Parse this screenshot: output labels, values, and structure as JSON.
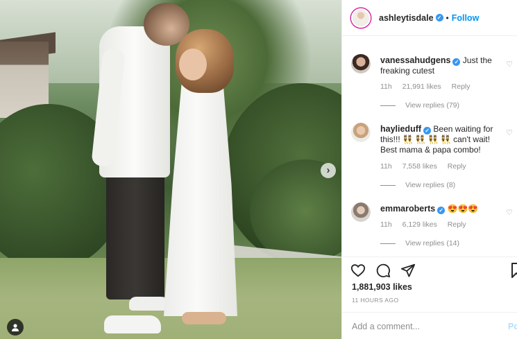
{
  "post": {
    "username": "ashleytisdale",
    "follow_label": "Follow",
    "separator": "•",
    "verified_glyph": "✓"
  },
  "comments": [
    {
      "username": "vanessahudgens",
      "text": "Just the freaking cutest",
      "time": "11h",
      "likes": "21,991 likes",
      "reply_label": "Reply",
      "view_replies": "View replies (79)"
    },
    {
      "username": "haylieduff",
      "text": "Been waiting for this!!! 👯 👯 👯 👯 can't wait! Best mama & papa combo!",
      "time": "11h",
      "likes": "7,558 likes",
      "reply_label": "Reply",
      "view_replies": "View replies (8)"
    },
    {
      "username": "emmaroberts",
      "text": "😍😍😍",
      "time": "11h",
      "likes": "6,129 likes",
      "reply_label": "Reply",
      "view_replies": "View replies (14)"
    }
  ],
  "stats": {
    "likes": "1,881,903 likes",
    "time_ago": "11 HOURS AGO"
  },
  "composer": {
    "placeholder": "Add a comment...",
    "post_label": "Po"
  },
  "icons": {
    "heart": "heart-icon",
    "comment": "comment-icon",
    "share": "share-icon",
    "bookmark": "bookmark-icon",
    "next": "chevron-right-icon",
    "tag": "user-tag-icon"
  },
  "colors": {
    "link_blue": "#0095f6",
    "verified_blue": "#3897f0",
    "muted_text": "#8e8e8e",
    "divider": "#efefef"
  }
}
